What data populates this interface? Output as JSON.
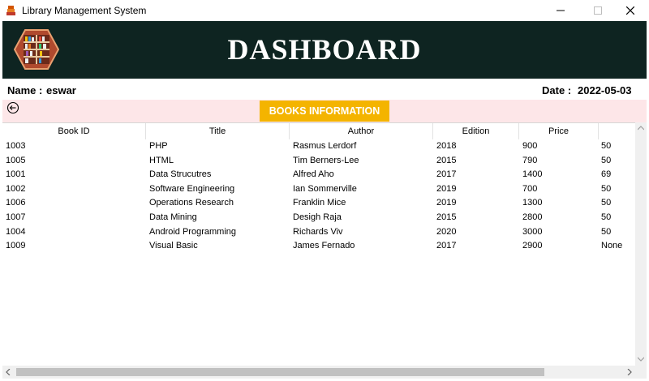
{
  "window": {
    "title": "Library Management System"
  },
  "header": {
    "title": "DASHBOARD"
  },
  "info": {
    "name_label": "Name :",
    "name_value": "eswar",
    "date_label": "Date :",
    "date_value": "2022-05-03"
  },
  "section": {
    "title": "BOOKS INFORMATION"
  },
  "table": {
    "columns": [
      "Book ID",
      "Title",
      "Author",
      "Edition",
      "Price",
      ""
    ],
    "rows": [
      [
        "1003",
        "PHP",
        "Rasmus Lerdorf",
        "2018",
        "900",
        "50"
      ],
      [
        "1005",
        "HTML",
        "Tim Berners-Lee",
        "2015",
        "790",
        "50"
      ],
      [
        "1001",
        "Data Strucutres",
        "Alfred Aho",
        "2017",
        "1400",
        "69"
      ],
      [
        "1002",
        "Software Engineering",
        "Ian Sommerville",
        "2019",
        "700",
        "50"
      ],
      [
        "1006",
        "Operations Research",
        "Franklin Mice",
        "2019",
        "1300",
        "50"
      ],
      [
        "1007",
        "Data Mining",
        "Desigh Raja",
        "2015",
        "2800",
        "50"
      ],
      [
        "1004",
        "Android Programming",
        "Richards Viv",
        "2020",
        "3000",
        "50"
      ],
      [
        "1009",
        "Visual Basic",
        "James Fernado",
        "2017",
        "2900",
        "None"
      ]
    ]
  },
  "icons": {
    "app": "library-app-icon",
    "logo": "bookshelf-logo-icon",
    "back": "back-arrow-icon",
    "minimize": "minimize-icon",
    "maximize": "maximize-icon",
    "close": "close-icon"
  },
  "colors": {
    "header_bg": "#0e2421",
    "section_badge": "#f4b400",
    "band_bg": "#fde6e8"
  }
}
